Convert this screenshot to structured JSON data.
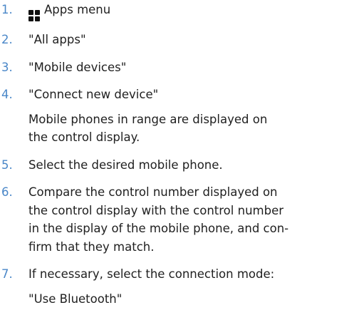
{
  "colors": {
    "accent": "#4a87c8",
    "text": "#1f1f1f"
  },
  "steps": [
    {
      "number": "1.",
      "icon": "apps-grid-icon",
      "lines": [
        "Apps menu"
      ]
    },
    {
      "number": "2.",
      "lines": [
        "\"All apps\""
      ]
    },
    {
      "number": "3.",
      "lines": [
        "\"Mobile devices\""
      ]
    },
    {
      "number": "4.",
      "lines": [
        "\"Connect new device\""
      ],
      "note": [
        "Mobile phones in range are displayed on",
        "the control display."
      ]
    },
    {
      "number": "5.",
      "lines": [
        "Select the desired mobile phone."
      ]
    },
    {
      "number": "6.",
      "lines": [
        "Compare the control number displayed on",
        "the control display with the control number",
        "in the display of the mobile phone, and con-",
        "firm that they match."
      ]
    },
    {
      "number": "7.",
      "lines": [
        "If necessary, select the connection mode:"
      ],
      "note": [
        "\"Use Bluetooth\""
      ]
    }
  ]
}
